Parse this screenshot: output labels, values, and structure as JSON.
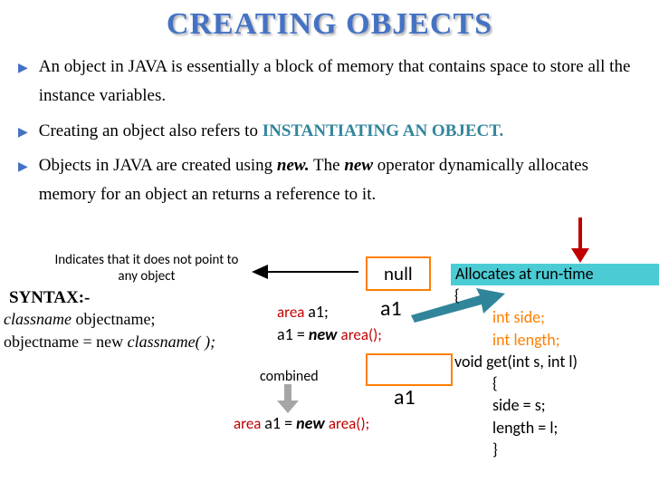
{
  "title": "CREATING OBJECTS",
  "bullets": [
    {
      "pre": "An object in JAVA is essentially a block of memory that contains space to store all the instance variables.",
      "mid": "",
      "post": ""
    },
    {
      "pre": "Creating an object also refers to ",
      "mid": "INSTANTIATING AN OBJECT.",
      "post": ""
    },
    {
      "pre": "Objects in JAVA are created using ",
      "mid": "new.",
      "post": " The ",
      "mid2": "new",
      "post2": " operator dynamically allocates memory for an object an returns a reference to it."
    }
  ],
  "note_noptr": "Indicates that it does not point to any object",
  "null_label": "null",
  "alloc_text": "Allocates at run-time",
  "syntax_hdr": "SYNTAX:-",
  "syntax_l1_a": "classname",
  "syntax_l1_b": "   objectname;",
  "syntax_l2_a": "objectname  =  new  ",
  "syntax_l2_b": "classname( );",
  "decl1a": "area ",
  "decl1b": "a1;",
  "decl2a": "a1 = ",
  "decl2b": "new ",
  "decl2c": "area();",
  "a1": "a1",
  "combined": "combined",
  "comb_a": "area ",
  "comb_b": "a1 = ",
  "comb_c": "new ",
  "comb_d": "area();",
  "class_code": {
    "l1": "{",
    "l2a": "int side;",
    "l2b": "int length;",
    "l3": "void get(int s, int l)",
    "l4": "{",
    "l5": "side = s;",
    "l6": "length =  l;",
    "l7": "}"
  }
}
